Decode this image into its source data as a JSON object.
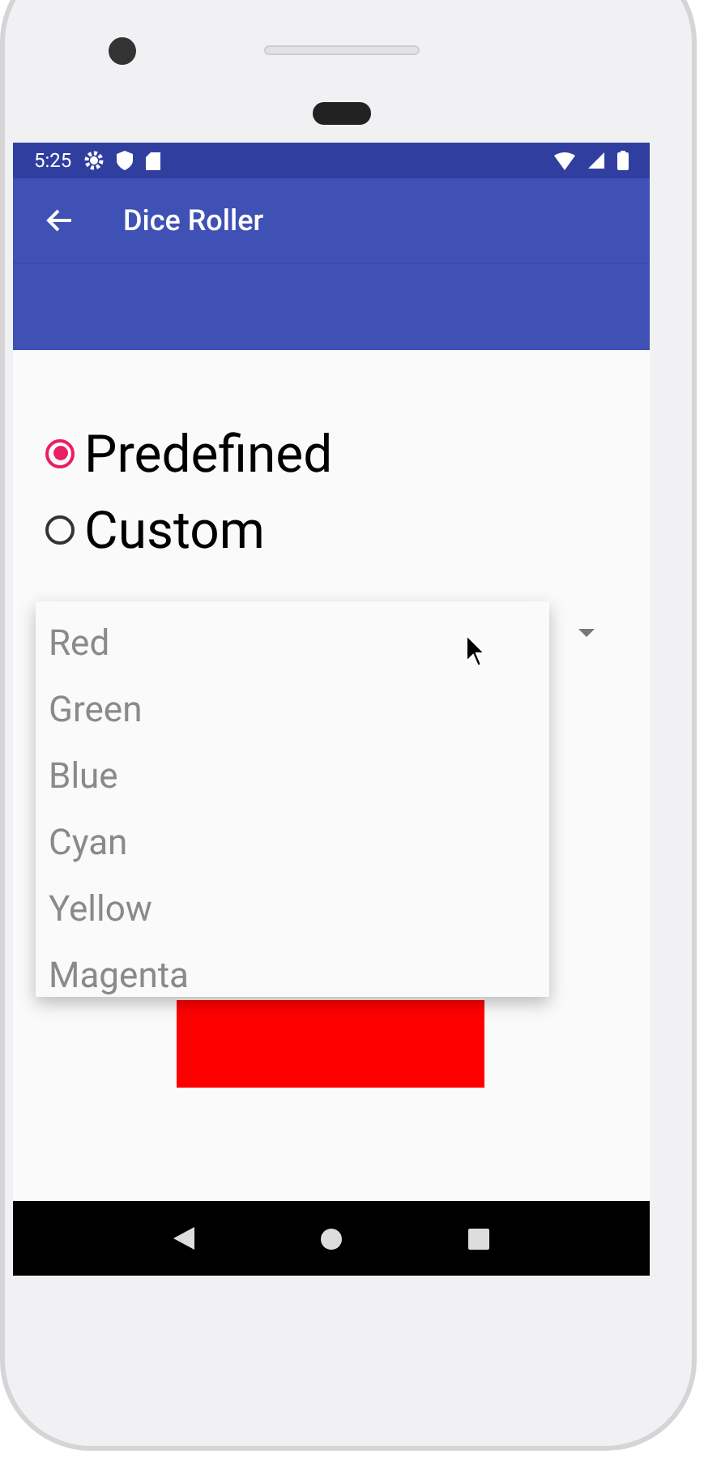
{
  "status_bar": {
    "time": "5:25"
  },
  "app_bar": {
    "title": "Dice Roller"
  },
  "radio_options": [
    {
      "label": "Predefined",
      "selected": true
    },
    {
      "label": "Custom",
      "selected": false
    }
  ],
  "dropdown": {
    "expanded": true,
    "items": [
      "Red",
      "Green",
      "Blue",
      "Cyan",
      "Yellow",
      "Magenta"
    ]
  },
  "swatch": {
    "color": "#ff0000"
  }
}
